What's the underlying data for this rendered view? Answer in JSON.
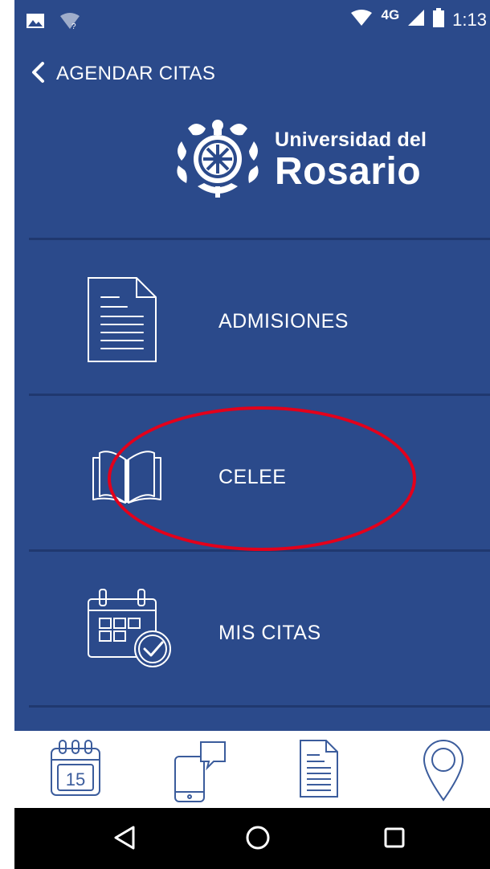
{
  "status_bar": {
    "network": "4G",
    "time": "1:13"
  },
  "header": {
    "title": "AGENDAR CITAS",
    "back_icon": "chevron-left-icon"
  },
  "logo": {
    "line1": "Universidad del",
    "line2": "Rosario"
  },
  "menu": {
    "items": [
      {
        "label": "ADMISIONES",
        "icon": "document-icon"
      },
      {
        "label": "CELEE",
        "icon": "open-book-icon"
      },
      {
        "label": "MIS CITAS",
        "icon": "calendar-check-icon"
      }
    ]
  },
  "tab_bar": {
    "tabs": [
      {
        "icon": "calendar-icon",
        "calendar_day": "15"
      },
      {
        "icon": "phone-chat-icon"
      },
      {
        "icon": "document-icon"
      },
      {
        "icon": "map-pin-icon"
      }
    ]
  },
  "colors": {
    "background": "#2b4a8b",
    "divider": "#20386f",
    "annotation": "#e3001b",
    "icon_outline": "#3b5c9c"
  }
}
